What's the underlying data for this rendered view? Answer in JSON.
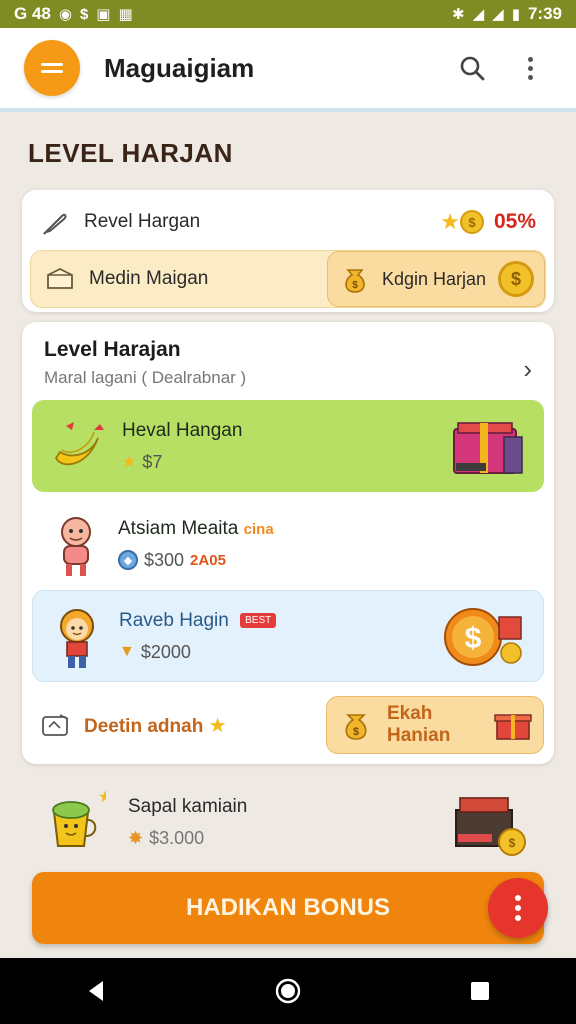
{
  "status_bar": {
    "left_text": "G 48",
    "time": "7:39"
  },
  "appbar": {
    "title": "Maguaigiam"
  },
  "section_title": "LEVEL HARJAN",
  "card1": {
    "row_label": "Revel Hargan",
    "percent": "05%",
    "bar_label": "Medin Maigan",
    "pill_label": "Kdgin Harjan"
  },
  "card2": {
    "title": "Level Harajan",
    "subtitle": "Maral lagani ( Dealrabnar )",
    "items": [
      {
        "name": "Heval Hangan",
        "price": "$7"
      },
      {
        "name": "Atsiam Meaita",
        "tag": "cina",
        "price": "$300",
        "price_tag": "2A05"
      },
      {
        "name": "Raveb Hagin",
        "badge": "BEST",
        "price": "$2000"
      }
    ],
    "footer_label": "Deetin adnah",
    "footer_pill_label": "Ekah Hanian"
  },
  "loose_item": {
    "name": "Sapal kamiain",
    "price": "$3.000"
  },
  "cta": {
    "label": "HADIKAN BONUS"
  },
  "colors": {
    "accent": "#f49a17",
    "cta": "#f0850d",
    "fab": "#e6352d",
    "status_bar": "#7f8c23",
    "green_item": "#b7df63",
    "blue_item": "#e2f1fb"
  }
}
